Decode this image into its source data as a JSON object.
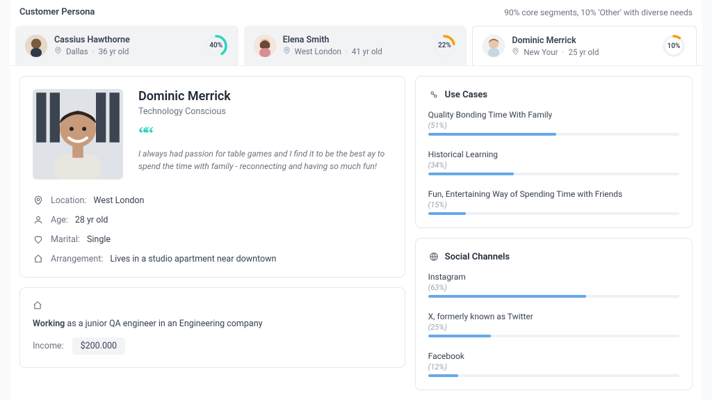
{
  "header": {
    "title": "Customer Persona",
    "subtitle": "90% core segments, 10% 'Other' with diverse needs"
  },
  "tabs": [
    {
      "name": "Cassius Hawthorne",
      "location": "Dallas",
      "age": "36 yr old",
      "pct": "40%",
      "pct_num": 40,
      "ring_color": "#2dd4bf",
      "active": false
    },
    {
      "name": "Elena Smith",
      "location": "West London",
      "age": "41 yr old",
      "pct": "22%",
      "pct_num": 22,
      "ring_color": "#f59e0b",
      "active": false
    },
    {
      "name": "Dominic Merrick",
      "location": "New Your",
      "age": "25 yr old",
      "pct": "10%",
      "pct_num": 10,
      "ring_color": "#f59e0b",
      "active": true
    }
  ],
  "profile": {
    "name": "Dominic Merrick",
    "tagline": "Technology Conscious",
    "quote": "I always had passion for table games and I find it to be the best ay to spend the time with family - reconnecting and having so much fun!",
    "info": {
      "location_label": "Location:",
      "location_value": "West London",
      "age_label": "Age:",
      "age_value": "28 yr old",
      "marital_label": "Marital:",
      "marital_value": "Single",
      "arrangement_label": "Arrangement:",
      "arrangement_value": "Lives in a studio apartment near downtown"
    }
  },
  "work": {
    "status_strong": "Working",
    "status_rest": " as a junior QA engineer in an Engineering company",
    "income_label": "Income:",
    "income_value": "$200.000"
  },
  "use_cases": {
    "title": "Use Cases",
    "items": [
      {
        "title": "Quality Bonding Time With Family",
        "pct_label": "(51%)",
        "pct": 51
      },
      {
        "title": "Historical Learning",
        "pct_label": "(34%)",
        "pct": 34
      },
      {
        "title": "Fun, Entertaining Way of Spending Time with Friends",
        "pct_label": "(15%)",
        "pct": 15
      }
    ]
  },
  "social": {
    "title": "Social Channels",
    "items": [
      {
        "title": "Instagram",
        "pct_label": "(63%)",
        "pct": 63
      },
      {
        "title": "X, formerly known as Twitter",
        "pct_label": "(25%)",
        "pct": 25
      },
      {
        "title": "Facebook",
        "pct_label": "(12%)",
        "pct": 12
      }
    ]
  }
}
